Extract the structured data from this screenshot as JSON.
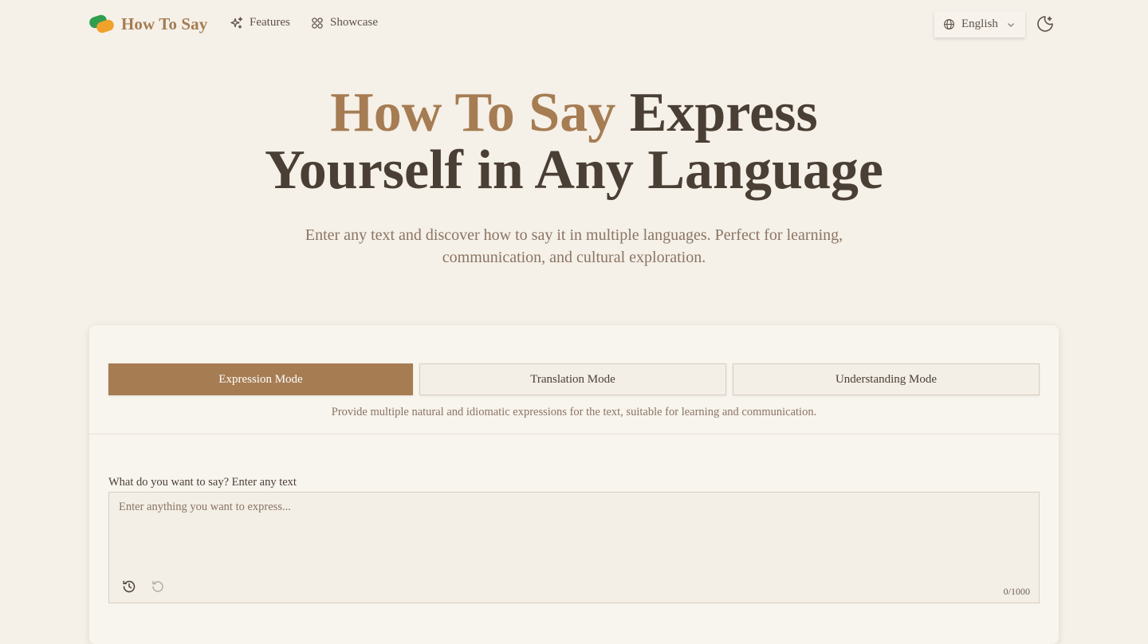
{
  "nav": {
    "brand": "How To Say",
    "links": [
      {
        "label": "Features",
        "icon": "sparkles-icon"
      },
      {
        "label": "Showcase",
        "icon": "grid-icon"
      }
    ],
    "language": {
      "value": "English",
      "icon": "globe-icon"
    },
    "theme_icon": "moon-sparkle-icon"
  },
  "hero": {
    "title_accent": "How To Say",
    "title_rest_line1": "Express",
    "title_line2": "Yourself in Any Language",
    "subtitle": "Enter any text and discover how to say it in multiple languages. Perfect for learning, communication, and cultural exploration."
  },
  "modes": {
    "items": [
      {
        "label": "Expression Mode",
        "active": true
      },
      {
        "label": "Translation Mode",
        "active": false
      },
      {
        "label": "Understanding Mode",
        "active": false
      }
    ],
    "description": "Provide multiple natural and idiomatic expressions for the text, suitable for learning and communication."
  },
  "input": {
    "label": "What do you want to say? Enter any text",
    "placeholder": "Enter anything you want to express...",
    "value": "",
    "char_count": "0/1000"
  },
  "colors": {
    "background": "#f5f0e8",
    "accent": "#a67c52",
    "text": "#4a3f35",
    "muted": "#8a7563",
    "logo_green": "#2e9e4f",
    "logo_orange": "#f0a22a"
  }
}
